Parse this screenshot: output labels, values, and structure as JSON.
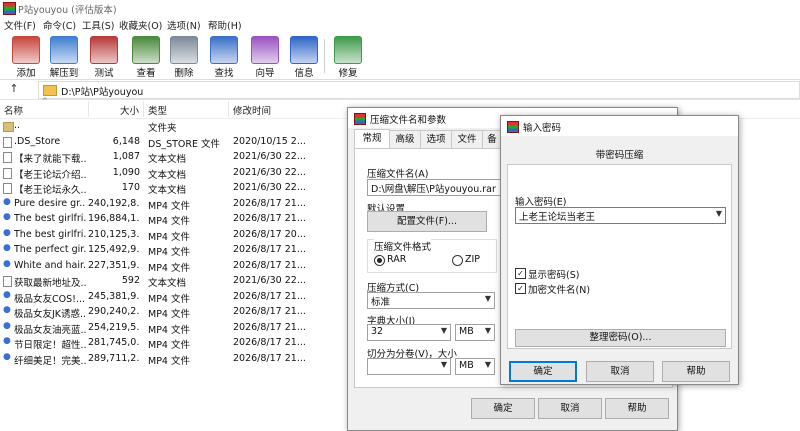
{
  "window": {
    "title": "P站youyou (评估版本)"
  },
  "menu": [
    "文件(F)",
    "命令(C)",
    "工具(S)",
    "收藏夹(O)",
    "选项(N)",
    "帮助(H)"
  ],
  "toolbar": [
    {
      "label": "添加",
      "icon": "add-archive-icon",
      "color": "#c9463d"
    },
    {
      "label": "解压到",
      "icon": "extract-folder-icon",
      "color": "#3f7fd1"
    },
    {
      "label": "测试",
      "icon": "test-checklist-icon",
      "color": "#b93a3a"
    },
    {
      "label": "查看",
      "icon": "view-book-icon",
      "color": "#4a8a3c"
    },
    {
      "label": "删除",
      "icon": "trash-icon",
      "color": "#7d8a98"
    },
    {
      "label": "查找",
      "icon": "magnifier-icon",
      "color": "#3b6fc7"
    },
    {
      "label": "向导",
      "icon": "wizard-wand-icon",
      "color": "#9a52c2"
    },
    {
      "label": "信息",
      "icon": "info-icon",
      "color": "#2f66c9"
    },
    {
      "label": "修复",
      "icon": "repair-kit-icon",
      "color": "#3f9b4a"
    }
  ],
  "address": {
    "path": "D:\\P站\\P站youyou",
    "up_glyph": "↑"
  },
  "columns": {
    "name": "名称",
    "size": "大小",
    "type": "类型",
    "modified": "修改时间"
  },
  "files": [
    {
      "name": "..",
      "size": "",
      "type": "文件夹",
      "modified": "",
      "kind": "fold"
    },
    {
      "name": ".DS_Store",
      "size": "6,148",
      "type": "DS_STORE 文件",
      "modified": "2020/10/15 2...",
      "kind": "doc"
    },
    {
      "name": "【来了就能下载...",
      "size": "1,087",
      "type": "文本文档",
      "modified": "2021/6/30 22...",
      "kind": "doc"
    },
    {
      "name": "【老王论坛介绍...",
      "size": "1,090",
      "type": "文本文档",
      "modified": "2021/6/30 22...",
      "kind": "doc"
    },
    {
      "name": "【老王论坛永久...",
      "size": "170",
      "type": "文本文档",
      "modified": "2021/6/30 22...",
      "kind": "doc"
    },
    {
      "name": "Pure desire gr...",
      "size": "240,192,8...",
      "type": "MP4 文件",
      "modified": "2026/8/17 21...",
      "kind": "mp4"
    },
    {
      "name": "The best girlfri...",
      "size": "196,884,1...",
      "type": "MP4 文件",
      "modified": "2026/8/17 21...",
      "kind": "mp4"
    },
    {
      "name": "The best girlfri...",
      "size": "210,125,3...",
      "type": "MP4 文件",
      "modified": "2026/8/17 20...",
      "kind": "mp4"
    },
    {
      "name": "The perfect gir...",
      "size": "125,492,9...",
      "type": "MP4 文件",
      "modified": "2026/8/17 21...",
      "kind": "mp4"
    },
    {
      "name": "White and hair...",
      "size": "227,351,9...",
      "type": "MP4 文件",
      "modified": "2026/8/17 21...",
      "kind": "mp4"
    },
    {
      "name": "获取最新地址及...",
      "size": "592",
      "type": "文本文档",
      "modified": "2021/6/30 22...",
      "kind": "doc"
    },
    {
      "name": "极品女友COS!...",
      "size": "245,381,9...",
      "type": "MP4 文件",
      "modified": "2026/8/17 21...",
      "kind": "mp4"
    },
    {
      "name": "极品女友JK诱惑...",
      "size": "290,240,2...",
      "type": "MP4 文件",
      "modified": "2026/8/17 21...",
      "kind": "mp4"
    },
    {
      "name": "极品女友油亮蓝...",
      "size": "254,219,5...",
      "type": "MP4 文件",
      "modified": "2026/8/17 21...",
      "kind": "mp4"
    },
    {
      "name": "节日限定！超性...",
      "size": "281,745,0...",
      "type": "MP4 文件",
      "modified": "2026/8/17 21...",
      "kind": "mp4"
    },
    {
      "name": "纤细美足！完美...",
      "size": "289,711,2...",
      "type": "MP4 文件",
      "modified": "2026/8/17 21...",
      "kind": "mp4"
    }
  ],
  "archive_dialog": {
    "title": "压缩文件名和参数",
    "tabs": [
      "常规",
      "高级",
      "选项",
      "文件",
      "备"
    ],
    "filename_label": "压缩文件名(A)",
    "filename_value": "D:\\网盘\\解压\\P站youyou.rar",
    "defaults_label": "默认设置",
    "profiles_button": "配置文件(F)...",
    "format_label": "压缩文件格式",
    "format_rar": "RAR",
    "format_zip": "ZIP",
    "method_label": "压缩方式(C)",
    "method_value": "标准",
    "dict_label": "字典大小(I)",
    "dict_value": "32",
    "dict_unit": "MB",
    "split_label": "切分为分卷(V)，大小",
    "split_value": "",
    "split_unit": "MB",
    "ok": "确定",
    "cancel": "取消",
    "help": "帮助"
  },
  "password_dialog": {
    "title": "输入密码",
    "heading": "带密码压缩",
    "input_label": "输入密码(E)",
    "input_value": "上老王论坛当老王",
    "show_password": "显示密码(S)",
    "encrypt_names": "加密文件名(N)",
    "manage_button": "整理密码(O)...",
    "ok": "确定",
    "cancel": "取消",
    "help": "帮助"
  }
}
